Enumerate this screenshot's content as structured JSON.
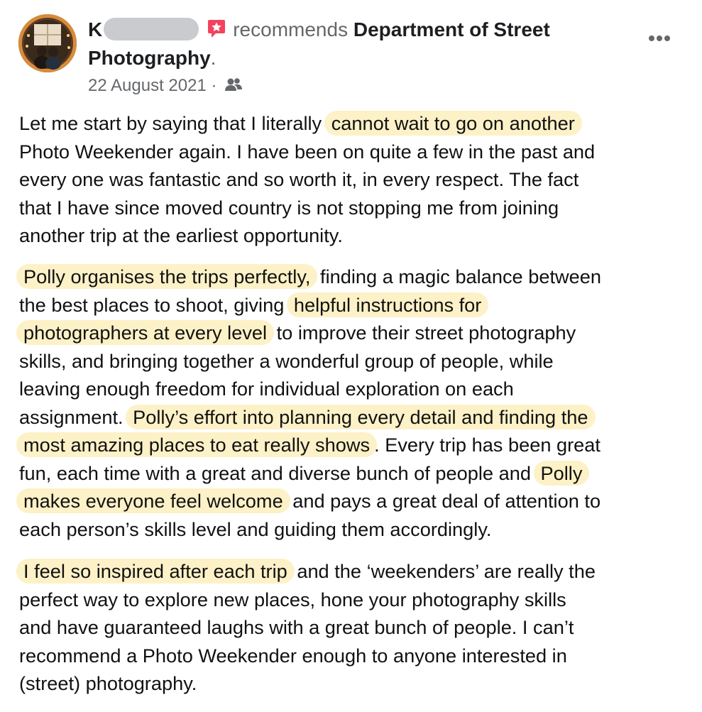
{
  "post": {
    "author_initial": "K",
    "recommends_text": "recommends",
    "page_name": "Department of Street Photography",
    "period": ".",
    "date": "22 August 2021",
    "date_sep": "·",
    "audience_icon": "friends-icon",
    "badge_icon": "star-badge-icon",
    "more_icon": "more-options-icon"
  },
  "review": {
    "p1": {
      "a": "Let me start by saying that I literally ",
      "b": "cannot wait to go on another",
      "c": "Photo Weekender again. I have been on quite a few in the past and",
      "d": "every one was fantastic and so worth it, in every respect. The fact",
      "e": "that I have since moved country is not stopping me from joining",
      "f": "another trip at the earliest opportunity."
    },
    "p2": {
      "a": "Polly organises the trips perfectly,",
      "b": " finding a magic balance between",
      "c": "the best places to shoot, giving ",
      "d": "helpful instructions for",
      "e": "photographers at every level",
      "f": " to improve their street photography",
      "g": "skills, and bringing together a wonderful group of people, while",
      "h": "leaving enough freedom for individual exploration on each",
      "i": " assignment. ",
      "j": "Polly’s effort into planning every detail and finding the",
      "k": "most amazing places to eat really shows",
      "l": ". Every trip has been great",
      "m": "fun, each time with a great and diverse bunch of people and ",
      "n": "Polly",
      "o": "makes everyone feel welcome",
      "p": " and pays a great deal of attention to",
      "q": "each person’s skills level and guiding them accordingly."
    },
    "p3": {
      "a": "I feel so inspired after each trip",
      "b": " and the ‘weekenders’ are really the",
      "c": "perfect way to explore new places, hone your photography skills",
      "d": "and have guaranteed laughs with a great bunch of people. I can’t",
      "e": "recommend a Photo Weekender enough to anyone interested in",
      "f": "(street) photography."
    }
  },
  "colors": {
    "highlight": "#fdf1c7",
    "muted_text": "#65676b",
    "badge": "#f3425f"
  }
}
